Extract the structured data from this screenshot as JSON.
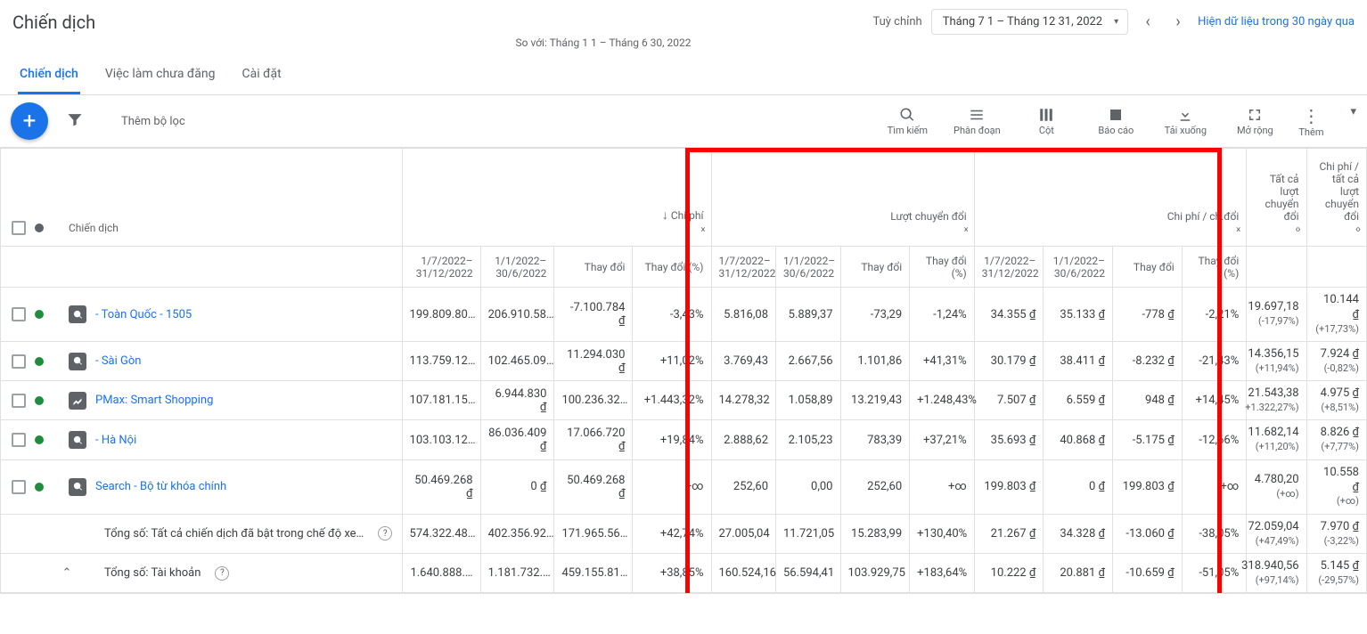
{
  "page_title": "Chiến dịch",
  "date_area": {
    "label": "Tuỳ chỉnh",
    "range": "Tháng 7 1 – Tháng 12 31, 2022",
    "compare": "So với: Tháng 1 1 – Tháng 6 30, 2022",
    "link30": "Hiện dữ liệu trong 30 ngày qua"
  },
  "tabs": [
    "Chiến dịch",
    "Việc làm chưa đăng",
    "Cài đặt"
  ],
  "add_filter": "Thêm bộ lọc",
  "toolbar_icons": {
    "search": "Tìm kiếm",
    "segment": "Phân đoạn",
    "columns": "Cột",
    "reports": "Báo cáo",
    "download": "Tải xuống",
    "expand": "Mở rộng",
    "more": "Thêm"
  },
  "head": {
    "campaign": "Chiến dịch",
    "cost": "Chi phí",
    "conv": "Lượt chuyển đổi",
    "cost_per_conv": "Chi phí / ch.đổi",
    "all_conv": "Tất cả lượt chuyển đổi",
    "cost_all_conv": "Chi phí / tất cả lượt chuyển đổi",
    "p1": "1/7/2022–31/12/2022",
    "p2": "1/1/2022–30/6/2022",
    "change": "Thay đổi",
    "change_pct": "Thay đổi (%)"
  },
  "rows": [
    {
      "type": "search",
      "name": "- Toàn Quốc - 1505",
      "cost": [
        "199.809.80…",
        "206.910.58…",
        "-7.100.784 ₫",
        "-3,43%"
      ],
      "conv": [
        "5.816,08",
        "5.889,37",
        "-73,29",
        "-1,24%"
      ],
      "cpc": [
        "34.355 ₫",
        "35.133 ₫",
        "-778 ₫",
        "-2,21%"
      ],
      "all_conv": [
        "19.697,18",
        "(-17,97%)"
      ],
      "cost_all": [
        "10.144 ₫",
        "(+17,73%)"
      ]
    },
    {
      "type": "search",
      "name": "- Sài Gòn",
      "cost": [
        "113.759.12…",
        "102.465.09…",
        "11.294.030 ₫",
        "+11,02%"
      ],
      "conv": [
        "3.769,43",
        "2.667,56",
        "1.101,86",
        "+41,31%"
      ],
      "cpc": [
        "30.179 ₫",
        "38.411 ₫",
        "-8.232 ₫",
        "-21,43%"
      ],
      "all_conv": [
        "14.356,15",
        "(+11,94%)"
      ],
      "cost_all": [
        "7.924 ₫",
        "(-0,82%)"
      ]
    },
    {
      "type": "pmax",
      "name": "PMax: Smart Shopping",
      "cost": [
        "107.181.15…",
        "6.944.830 ₫",
        "100.236.32…",
        "+1.443,32%"
      ],
      "conv": [
        "14.278,32",
        "1.058,89",
        "13.219,43",
        "+1.248,43%"
      ],
      "cpc": [
        "7.507 ₫",
        "6.559 ₫",
        "948 ₫",
        "+14,45%"
      ],
      "all_conv": [
        "21.543,38",
        "+1.322,27%)"
      ],
      "cost_all": [
        "4.975 ₫",
        "(+8,51%)"
      ]
    },
    {
      "type": "search",
      "name": "- Hà Nội",
      "cost": [
        "103.103.12…",
        "86.036.409 ₫",
        "17.066.720 ₫",
        "+19,84%"
      ],
      "conv": [
        "2.888,62",
        "2.105,23",
        "783,39",
        "+37,21%"
      ],
      "cpc": [
        "35.693 ₫",
        "40.868 ₫",
        "-5.175 ₫",
        "-12,66%"
      ],
      "all_conv": [
        "11.682,14",
        "(+11,20%)"
      ],
      "cost_all": [
        "8.826 ₫",
        "(+7,77%)"
      ]
    },
    {
      "type": "search",
      "name": "Search - Bộ từ khóa chính",
      "cost": [
        "50.469.268 ₫",
        "0 ₫",
        "50.469.268 ₫",
        "+∞"
      ],
      "conv": [
        "252,60",
        "0,00",
        "252,60",
        "+∞"
      ],
      "cpc": [
        "199.803 ₫",
        "0 ₫",
        "199.803 ₫",
        "+∞"
      ],
      "all_conv": [
        "4.780,20",
        "(+∞)"
      ],
      "cost_all": [
        "10.558 ₫",
        "(+∞)"
      ]
    }
  ],
  "totals": {
    "enabled": {
      "label": "Tổng số: Tất cả chiến dịch đã bật trong chế độ xe…",
      "cost": [
        "574.322.48…",
        "402.356.92…",
        "171.965.56…",
        "+42,74%"
      ],
      "conv": [
        "27.005,04",
        "11.721,05",
        "15.283,99",
        "+130,40%"
      ],
      "cpc": [
        "21.267 ₫",
        "34.328 ₫",
        "-13.060 ₫",
        "-38,05%"
      ],
      "all_conv": [
        "72.059,04",
        "(+47,49%)"
      ],
      "cost_all": [
        "7.970 ₫",
        "(-3,22%)"
      ]
    },
    "account": {
      "label": "Tổng số: Tài khoản",
      "cost": [
        "1.640.888.…",
        "1.181.732.…",
        "459.155.81…",
        "+38,85%"
      ],
      "conv": [
        "160.524,16",
        "56.594,41",
        "103.929,75",
        "+183,64%"
      ],
      "cpc": [
        "10.222 ₫",
        "20.881 ₫",
        "-10.659 ₫",
        "-51,05%"
      ],
      "all_conv": [
        "318.940,56",
        "(+97,14%)"
      ],
      "cost_all": [
        "5.145 ₫",
        "(-29,57%)"
      ]
    }
  }
}
